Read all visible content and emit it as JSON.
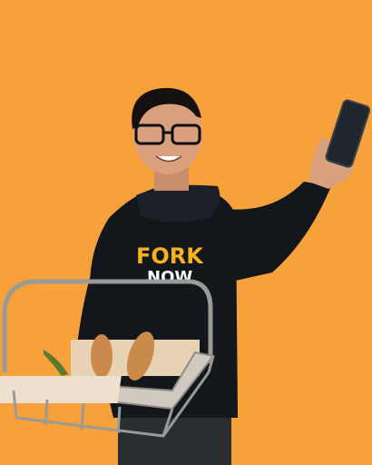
{
  "scene": {
    "background": "#F7A13A",
    "hoodie_logo": {
      "line1": "FORK",
      "line2": "NOW",
      "color_fork": "#F6B21A",
      "color_now": "#FFFFFF"
    },
    "colors": {
      "hoodie": "#13161B",
      "skin": "#D9A07E",
      "hair": "#16110E",
      "phone": "#20262D",
      "basket_wire": "#9C9A96",
      "box": "#E7D2B4",
      "bread": "#C98A4A",
      "herb": "#5C7A2E"
    }
  }
}
